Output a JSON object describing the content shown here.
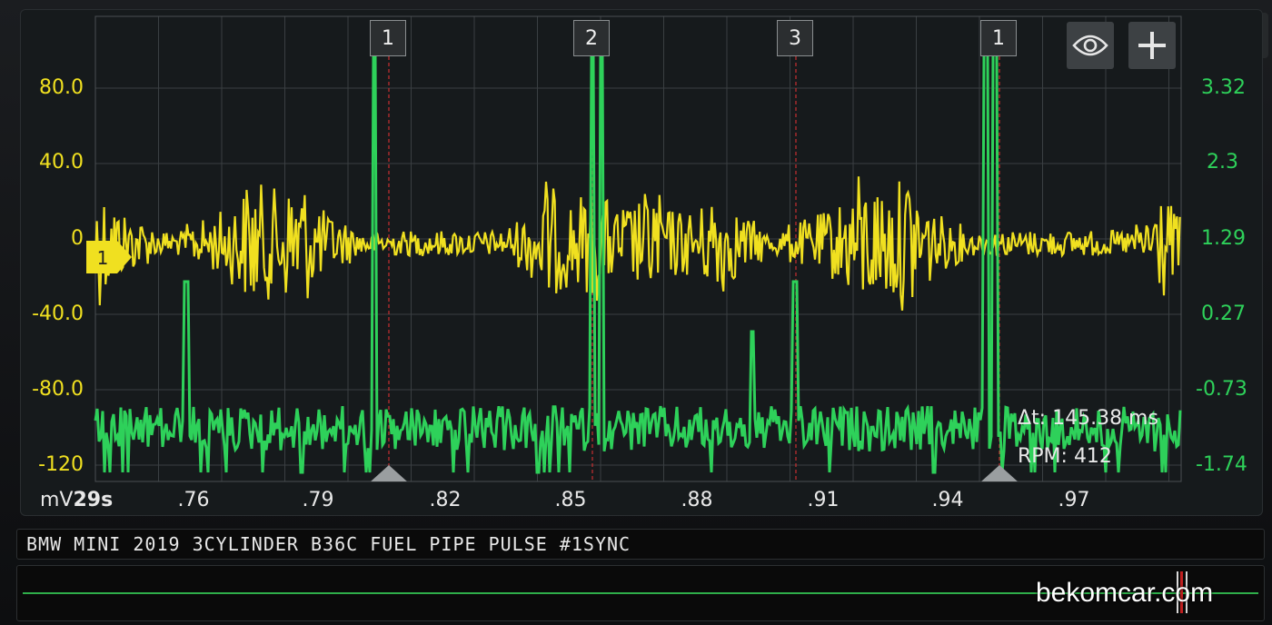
{
  "colors": {
    "channel_a": "#f0e020",
    "channel_b": "#2ed15a",
    "cursor_line": "#c83030",
    "grid": "#3a3f42"
  },
  "axes": {
    "left_unit": "mV",
    "left_ticks": [
      "80.0",
      "40.0",
      "0",
      "-40.0",
      "-80.0",
      "-120"
    ],
    "right_ticks": [
      "3.32",
      "2.3",
      "1.29",
      "0.27",
      "-0.73",
      "-1.74"
    ],
    "time_base": "29s",
    "x_ticks": [
      ".76",
      ".79",
      ".82",
      ".85",
      ".88",
      ".91",
      ".94",
      ".97"
    ]
  },
  "cursors": [
    {
      "label": "1"
    },
    {
      "label": "2"
    },
    {
      "label": "3"
    },
    {
      "label": "1"
    }
  ],
  "channel_marker": "1",
  "measurements": {
    "delta_t": "Δt: 145.38 ms",
    "rpm": "RPM: 412"
  },
  "controls": {
    "eye_icon": "eye-icon",
    "add_icon": "plus-icon"
  },
  "title": "BMW MINI 2019 3CYLINDER B36C FUEL PIPE PULSE #1SYNC",
  "watermark": "bekomcar.com"
}
